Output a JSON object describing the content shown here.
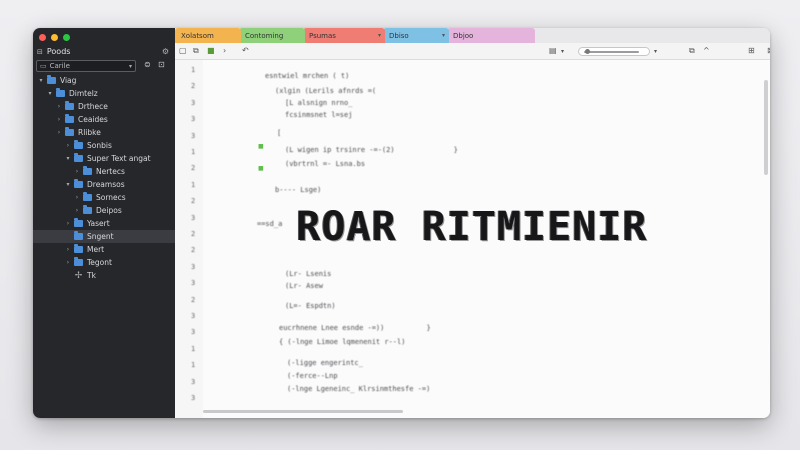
{
  "sidebar": {
    "title": "Poods",
    "search_placeholder": "Carile",
    "tree": [
      {
        "label": "Viag",
        "indent": 0,
        "arrow": "▾",
        "icon": "folder"
      },
      {
        "label": "Dimtelz",
        "indent": 1,
        "arrow": "▾",
        "icon": "folder"
      },
      {
        "label": "Drthece",
        "indent": 2,
        "arrow": "›",
        "icon": "folder"
      },
      {
        "label": "Ceaides",
        "indent": 2,
        "arrow": "›",
        "icon": "folder"
      },
      {
        "label": "Rlibke",
        "indent": 2,
        "arrow": "›",
        "icon": "folder"
      },
      {
        "label": "Sonbis",
        "indent": 3,
        "arrow": "›",
        "icon": "folder"
      },
      {
        "label": "Super Text angat",
        "indent": 3,
        "arrow": "▾",
        "icon": "folder"
      },
      {
        "label": "Nertecs",
        "indent": 4,
        "arrow": "›",
        "icon": "folder"
      },
      {
        "label": "Dreamsos",
        "indent": 3,
        "arrow": "▾",
        "icon": "folder"
      },
      {
        "label": "Sornecs",
        "indent": 4,
        "arrow": "›",
        "icon": "folder"
      },
      {
        "label": "Deipos",
        "indent": 4,
        "arrow": "›",
        "icon": "folder"
      },
      {
        "label": "Yasert",
        "indent": 3,
        "arrow": "›",
        "icon": "folder"
      },
      {
        "label": "Sngent",
        "indent": 3,
        "arrow": "",
        "icon": "folder",
        "selected": true
      },
      {
        "label": "Mert",
        "indent": 3,
        "arrow": "›",
        "icon": "folder"
      },
      {
        "label": "Tegont",
        "indent": 3,
        "arrow": "›",
        "icon": "folder"
      },
      {
        "label": "Tk",
        "indent": 3,
        "arrow": "",
        "icon": "plus"
      }
    ]
  },
  "tabs": [
    {
      "label": "Xolatsom",
      "color": "#f3b34e"
    },
    {
      "label": "Contoming",
      "color": "#8fd17a"
    },
    {
      "label": "Psumas",
      "color": "#ef7d74"
    },
    {
      "label": "Dbiso",
      "color": "#7fc1e4"
    },
    {
      "label": "Dbjoo",
      "color": "#e4b4dc"
    }
  ],
  "overlay": {
    "title": "ROAR RITMIENIR"
  },
  "code_lines": [
    "esntwiel mrchen ( t)",
    "(xlgin (Lerils afnrds =(",
    "[L alsnign nrno_",
    "fcsinmsnet l=sej",
    "[",
    "(L wigen ip trsinre -=-(2)              }",
    "(vbrtrnl =- Lsna.bs",
    "b---- Lsge)",
    "==sd_a",
    "(Lr- Lsenis",
    "(Lr- Asew",
    "(L=- Espdtn)",
    "eucrhnene Lnee esnde -=))          }",
    "{ (-lnge Limoe lqmenenit r--l)",
    "(-ligge engerintc_",
    "(-ferce--Lnp",
    "(-lnge Lgeneinc_ Klrsinmthesfe -=)"
  ],
  "line_numbers": [
    "1",
    "2",
    "3",
    "3",
    "3",
    "1",
    "2",
    "1",
    "2",
    "3",
    "2",
    "2",
    "3",
    "3",
    "2",
    "3",
    "3",
    "1",
    "1",
    "3",
    "3"
  ]
}
